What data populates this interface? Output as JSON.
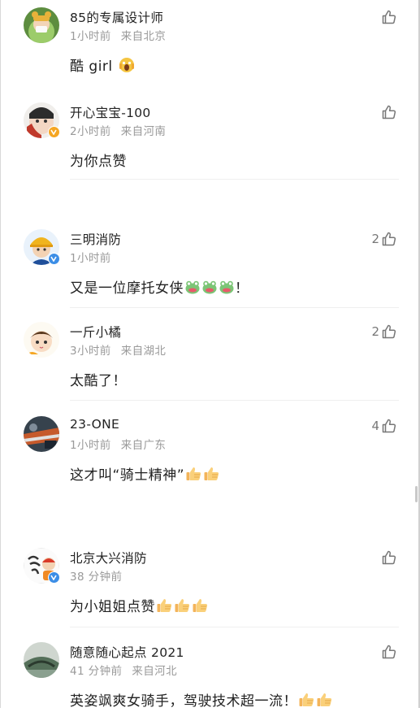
{
  "comments": [
    {
      "username": "85的专属设计师",
      "time": "1小时前",
      "location": "来自北京",
      "text": "酷 girl",
      "emoji": [
        "scream-emoji"
      ],
      "likes": ""
    },
    {
      "username": "开心宝宝-100",
      "time": "2小时前",
      "location": "来自河南",
      "text": "为你点赞",
      "emoji": [],
      "likes": ""
    },
    {
      "username": "三明消防",
      "time": "1小时前",
      "location": "",
      "text": "又是一位摩托女侠",
      "text_after": "！",
      "emoji": [
        "frog-emoji",
        "frog-emoji",
        "frog-emoji"
      ],
      "likes": "2"
    },
    {
      "username": "一斤小橘",
      "time": "3小时前",
      "location": "来自湖北",
      "text": "太酷了！",
      "emoji": [],
      "likes": "2"
    },
    {
      "username": "23-ONE",
      "time": "1小时前",
      "location": "来自广东",
      "text": "这才叫“骑士精神”",
      "emoji": [
        "thumbs-up-emoji",
        "thumbs-up-emoji"
      ],
      "likes": "4"
    },
    {
      "username": "北京大兴消防",
      "time": "38 分钟前",
      "location": "",
      "text": "为小姐姐点赞",
      "emoji": [
        "thumbs-up-emoji",
        "thumbs-up-emoji",
        "thumbs-up-emoji"
      ],
      "likes": ""
    },
    {
      "username": "随意随心起点 2021",
      "time": "41 分钟前",
      "location": "来自河北",
      "text": "英姿飒爽女骑手，驾驶技术超一流！",
      "emoji": [
        "thumbs-up-emoji",
        "thumbs-up-emoji"
      ],
      "likes": ""
    }
  ],
  "colors": {
    "text": "#222222",
    "meta": "#9a9a9a",
    "like": "#777777",
    "verified_orange": "#f5a623",
    "verified_blue": "#3c8ee6"
  }
}
